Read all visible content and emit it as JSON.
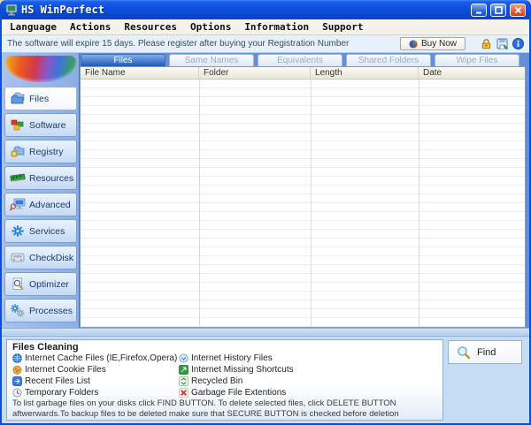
{
  "window": {
    "title": "HS WinPerfect"
  },
  "menu": {
    "items": [
      "Language",
      "Actions",
      "Resources",
      "Options",
      "Information",
      "Support"
    ]
  },
  "notice": {
    "text": "The software will expire 15 days. Please register after buying your Registration Number",
    "buy_now_label": "Buy Now"
  },
  "tabs": [
    {
      "label": "Files",
      "active": true
    },
    {
      "label": "Same Names",
      "active": false
    },
    {
      "label": "Equivalents",
      "active": false
    },
    {
      "label": "Shared Folders",
      "active": false
    },
    {
      "label": "Wipe Files",
      "active": false
    }
  ],
  "table": {
    "columns": [
      "File Name",
      "Folder",
      "Length",
      "Date"
    ],
    "rows": []
  },
  "sidebar": {
    "items": [
      {
        "label": "Files",
        "icon": "folder-icon",
        "active": true
      },
      {
        "label": "Software",
        "icon": "software-blocks-icon",
        "active": false
      },
      {
        "label": "Registry",
        "icon": "registry-icon",
        "active": false
      },
      {
        "label": "Resources",
        "icon": "memory-chip-icon",
        "active": false
      },
      {
        "label": "Advanced",
        "icon": "computer-search-icon",
        "active": false
      },
      {
        "label": "Services",
        "icon": "gear-icon",
        "active": false
      },
      {
        "label": "CheckDisk",
        "icon": "hard-drive-icon",
        "active": false
      },
      {
        "label": "Optimizer",
        "icon": "magnifier-document-icon",
        "active": false
      },
      {
        "label": "Processes",
        "icon": "gears-icon",
        "active": false
      }
    ]
  },
  "cleaning": {
    "title": "Files Cleaning",
    "left_items": [
      {
        "label": "Internet Cache Files (IE,Firefox,Opera)",
        "icon": "globe-icon"
      },
      {
        "label": "Internet Cookie Files",
        "icon": "cookie-icon"
      },
      {
        "label": "Recent Files List",
        "icon": "recent-files-icon"
      },
      {
        "label": "Temporary Folders",
        "icon": "temp-folder-icon"
      }
    ],
    "right_items": [
      {
        "label": "Internet History Files",
        "icon": "history-clock-icon"
      },
      {
        "label": "Internet Missing Shortcuts",
        "icon": "shortcut-icon"
      },
      {
        "label": "Recycled Bin",
        "icon": "recycle-bin-icon"
      },
      {
        "label": "Garbage File Extentions",
        "icon": "red-x-icon"
      }
    ],
    "find_label": "Find",
    "instructions": "To list garbage files on your disks click FIND BUTTON. To delete selected files, click DELETE BUTTON aftwerwards.To backup files to be deleted make sure that SECURE BUTTON is checked before deletion process.To restore items deleted,click on"
  },
  "colors": {
    "titlebar_blue": "#0f4fe0",
    "active_tab_blue": "#2058b8",
    "sidebar_button_blue": "#c4d9f4",
    "notice_bg": "#e7f1fc",
    "table_header_tan": "#eae7d6",
    "close_button_red": "#e4663c"
  }
}
